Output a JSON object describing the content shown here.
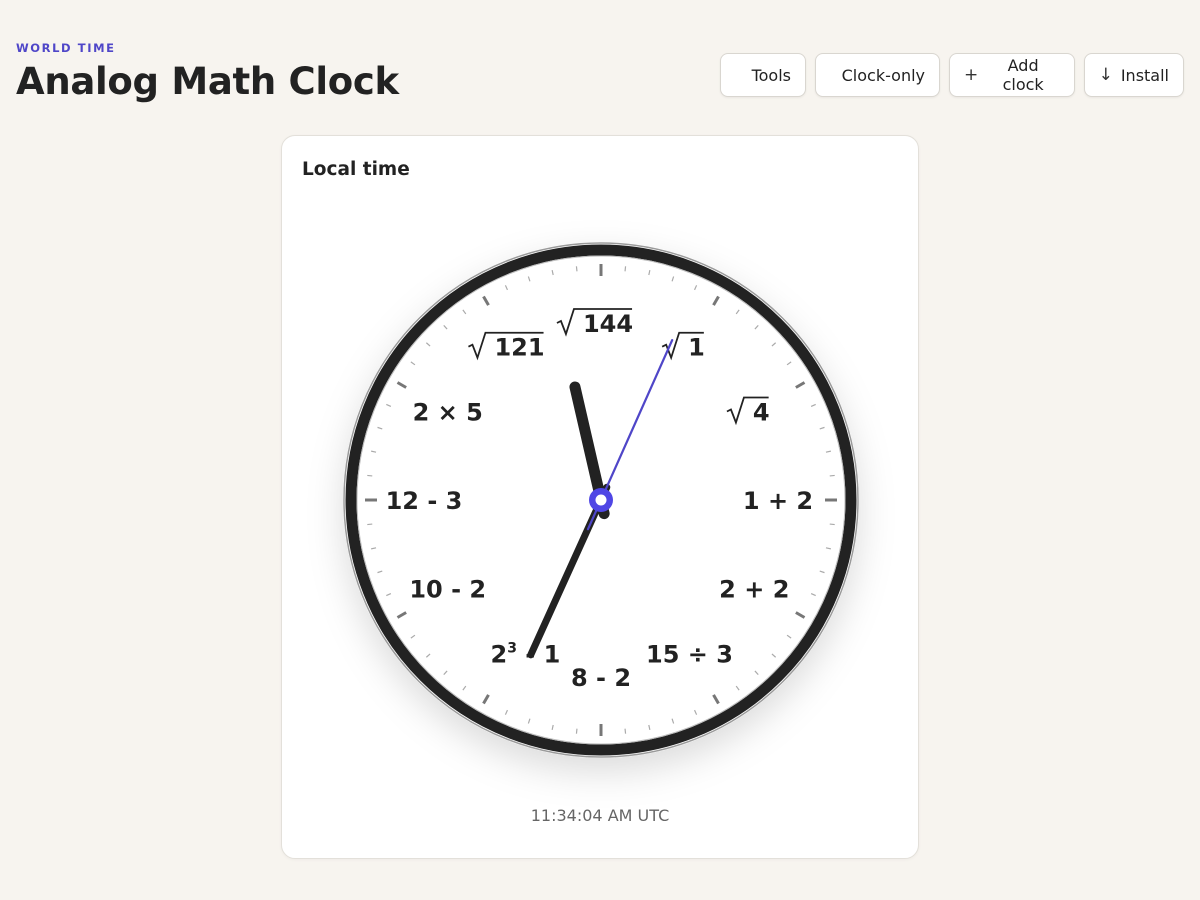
{
  "header": {
    "eyebrow": "WORLD TIME",
    "title": "Analog Math Clock"
  },
  "toolbar": {
    "tools_label": "Tools",
    "clock_only_label": "Clock-only",
    "add_clock_label": "Add clock",
    "add_clock_icon": "plus-icon",
    "install_label": "Install",
    "install_icon": "download-arrow-icon"
  },
  "clock": {
    "card_title": "Local time",
    "readout": "11:34:04 AM UTC",
    "time": {
      "hours": 11,
      "minutes": 34,
      "seconds": 4
    },
    "numerals": [
      {
        "hour": 12,
        "text": "144",
        "kind": "sqrt"
      },
      {
        "hour": 1,
        "text": "1",
        "kind": "sqrt"
      },
      {
        "hour": 2,
        "text": "4",
        "kind": "sqrt"
      },
      {
        "hour": 3,
        "text": "1 + 2",
        "kind": "plain"
      },
      {
        "hour": 4,
        "text": "2 + 2",
        "kind": "plain"
      },
      {
        "hour": 5,
        "text": "15 ÷ 3",
        "kind": "plain"
      },
      {
        "hour": 6,
        "text": "8 - 2",
        "kind": "plain"
      },
      {
        "hour": 7,
        "text": "2",
        "sup": "3",
        "rest": " - 1",
        "kind": "power"
      },
      {
        "hour": 8,
        "text": "10 - 2",
        "kind": "plain"
      },
      {
        "hour": 9,
        "text": "12 - 3",
        "kind": "plain"
      },
      {
        "hour": 10,
        "text": "2 × 5",
        "kind": "plain"
      },
      {
        "hour": 11,
        "text": "121",
        "kind": "sqrt"
      }
    ],
    "colors": {
      "rim": "#222222",
      "hands": "#222222",
      "second_hand": "#4f46c8",
      "hub": "#4f46e5",
      "accent": "#4f46c8"
    }
  }
}
